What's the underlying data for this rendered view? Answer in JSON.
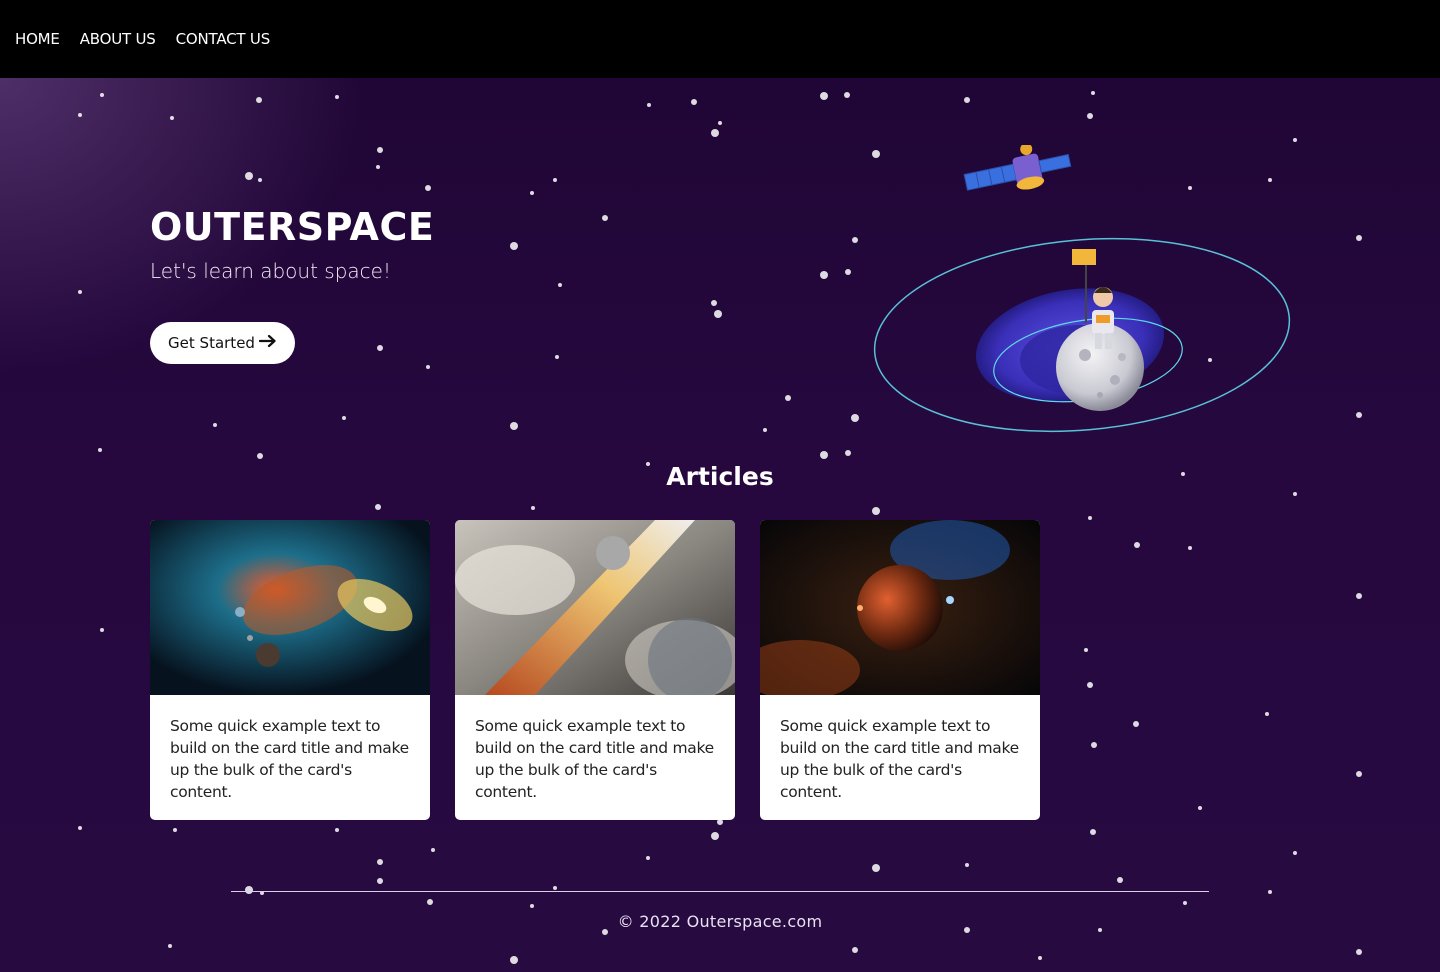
{
  "nav": {
    "items": [
      {
        "label": "HOME"
      },
      {
        "label": "ABOUT US"
      },
      {
        "label": "CONTACT US"
      }
    ]
  },
  "hero": {
    "title": "OUTERSPACE",
    "subtitle": "Let's learn about space!",
    "cta_label": "Get Started",
    "cta_icon": "arrow-right-icon"
  },
  "articles": {
    "title": "Articles",
    "cards": [
      {
        "image": "galaxy-nebula-image",
        "text": "Some quick example text to build on the card title and make up the bulk of the card's content."
      },
      {
        "image": "cloud-light-beam-image",
        "text": "Some quick example text to build on the card title and make up the bulk of the card's content."
      },
      {
        "image": "burning-planet-image",
        "text": "Some quick example text to build on the card title and make up the bulk of the card's content."
      }
    ]
  },
  "footer": {
    "text": "© 2022 Outerspace.com"
  },
  "colors": {
    "nav_bg": "#000000",
    "page_bg": "#230739",
    "card_bg": "#ffffff",
    "button_bg": "#ffffff"
  }
}
